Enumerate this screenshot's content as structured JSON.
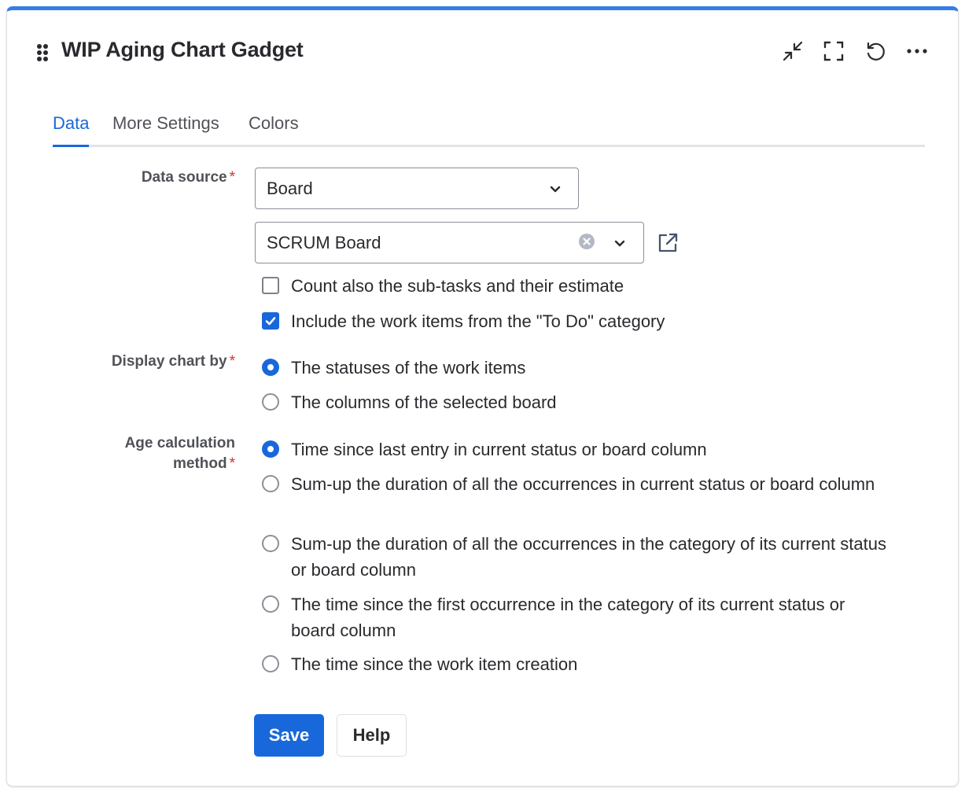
{
  "gadget": {
    "title": "WIP Aging Chart Gadget",
    "accent_color": "#357de8",
    "header_icons": [
      "minimize-icon",
      "fullscreen-icon",
      "refresh-icon",
      "more-icon"
    ]
  },
  "tabs": [
    {
      "label": "Data",
      "active": true
    },
    {
      "label": "More Settings",
      "active": false
    },
    {
      "label": "Colors",
      "active": false
    }
  ],
  "form": {
    "data_source": {
      "label": "Data source",
      "required_mark": "*",
      "type_value": "Board",
      "board_value": "SCRUM Board"
    },
    "checkboxes": [
      {
        "label": "Count also the sub-tasks and their estimate",
        "checked": false
      },
      {
        "label": "Include the work items from the \"To Do\" category",
        "checked": true
      }
    ],
    "display_chart_by": {
      "label": "Display chart by",
      "required_mark": "*",
      "options": [
        {
          "label": "The statuses of the work items",
          "selected": true
        },
        {
          "label": "The columns of the selected board",
          "selected": false
        }
      ]
    },
    "age_calculation": {
      "label_line1": "Age calculation",
      "label_line2": "method",
      "required_mark": "*",
      "options": [
        {
          "label": "Time since last entry in current status or board column",
          "selected": true
        },
        {
          "label": "Sum-up the duration of all the occurrences in current status or board column",
          "selected": false
        },
        {
          "label": "Sum-up the duration of all the occurrences in the category of its current status or board column",
          "selected": false
        },
        {
          "label": "The time since the first occurrence in the category of its current status or board column",
          "selected": false
        },
        {
          "label": "The time since the work item creation",
          "selected": false
        }
      ]
    }
  },
  "buttons": {
    "save_label": "Save",
    "help_label": "Help",
    "primary_color": "#1868db"
  }
}
